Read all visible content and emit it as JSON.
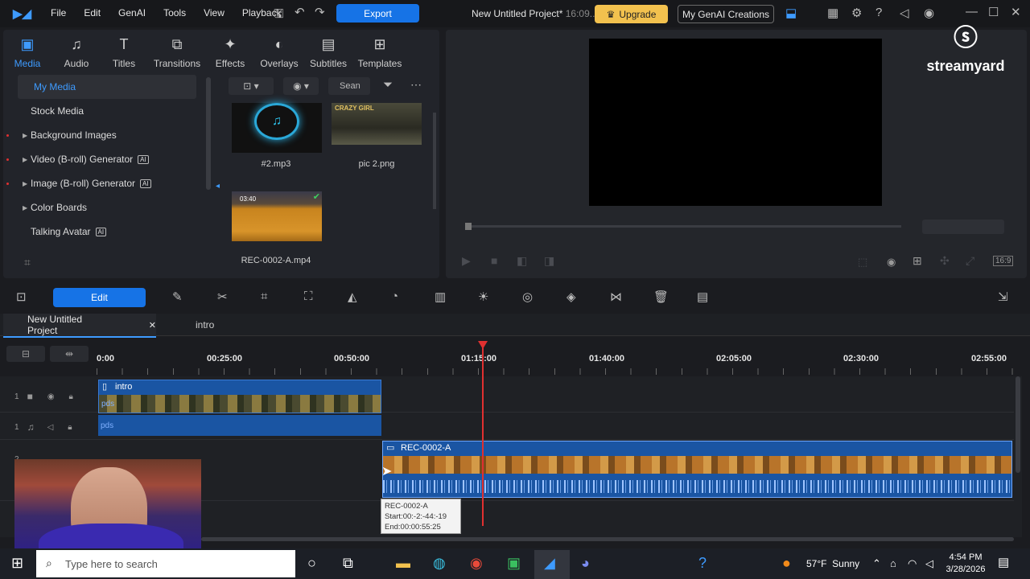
{
  "menu": {
    "items": [
      "File",
      "Edit",
      "GenAI",
      "Tools",
      "View",
      "Playback"
    ]
  },
  "toolbar": {
    "export_label": "Export",
    "project_title": "New Untitled Project*",
    "project_time": "16:09...",
    "upgrade_label": "Upgrade",
    "creations_label": "My GenAI Creations"
  },
  "lib_tabs": [
    {
      "label": "Media"
    },
    {
      "label": "Audio"
    },
    {
      "label": "Titles"
    },
    {
      "label": "Transitions"
    },
    {
      "label": "Effects"
    },
    {
      "label": "Overlays"
    },
    {
      "label": "Subtitles"
    },
    {
      "label": "Templates"
    }
  ],
  "lib_tree": {
    "my_media": "My Media",
    "stock_media": "Stock Media",
    "background_images": "Background Images",
    "video_generator": "Video (B-roll) Generator",
    "image_generator": "Image (B-roll) Generator",
    "color_boards": "Color Boards",
    "talking_avatar": "Talking Avatar",
    "ai_badge": "AI"
  },
  "media_toolbar": {
    "search_placeholder": "Sean"
  },
  "media_items": [
    {
      "name": "#2.mp3"
    },
    {
      "name": "pic 2.png",
      "thumb_text": "CRAZY GIRL"
    },
    {
      "name": "REC-0002-A.mp4",
      "duration": "03:40"
    }
  ],
  "watermark": {
    "text": "streamyard"
  },
  "edit_toolbar": {
    "edit_label": "Edit"
  },
  "project_tabs": {
    "tab1": "New Untitled Project",
    "tab2": "intro"
  },
  "ruler": {
    "ticks": [
      "0:00",
      "00:25:00",
      "00:50:00",
      "01:15:00",
      "01:40:00",
      "02:05:00",
      "02:30:00",
      "02:55:00"
    ]
  },
  "tracks": {
    "video1_num": "1",
    "audio1_num": "1",
    "video2_num": "2",
    "intro_clip": "intro",
    "intro_audio_label": "pds",
    "intro_video_label": "pds",
    "rec_clip": "REC-0002-A"
  },
  "tooltip": {
    "name": "REC-0002-A",
    "start": "Start:00:-2:-44:-19",
    "end": "End:00:00:55:25"
  },
  "taskbar": {
    "search_placeholder": "Type here to search",
    "temperature": "57°F",
    "weather": "Sunny",
    "time": "4:54 PM",
    "date": "3/28/2026"
  }
}
